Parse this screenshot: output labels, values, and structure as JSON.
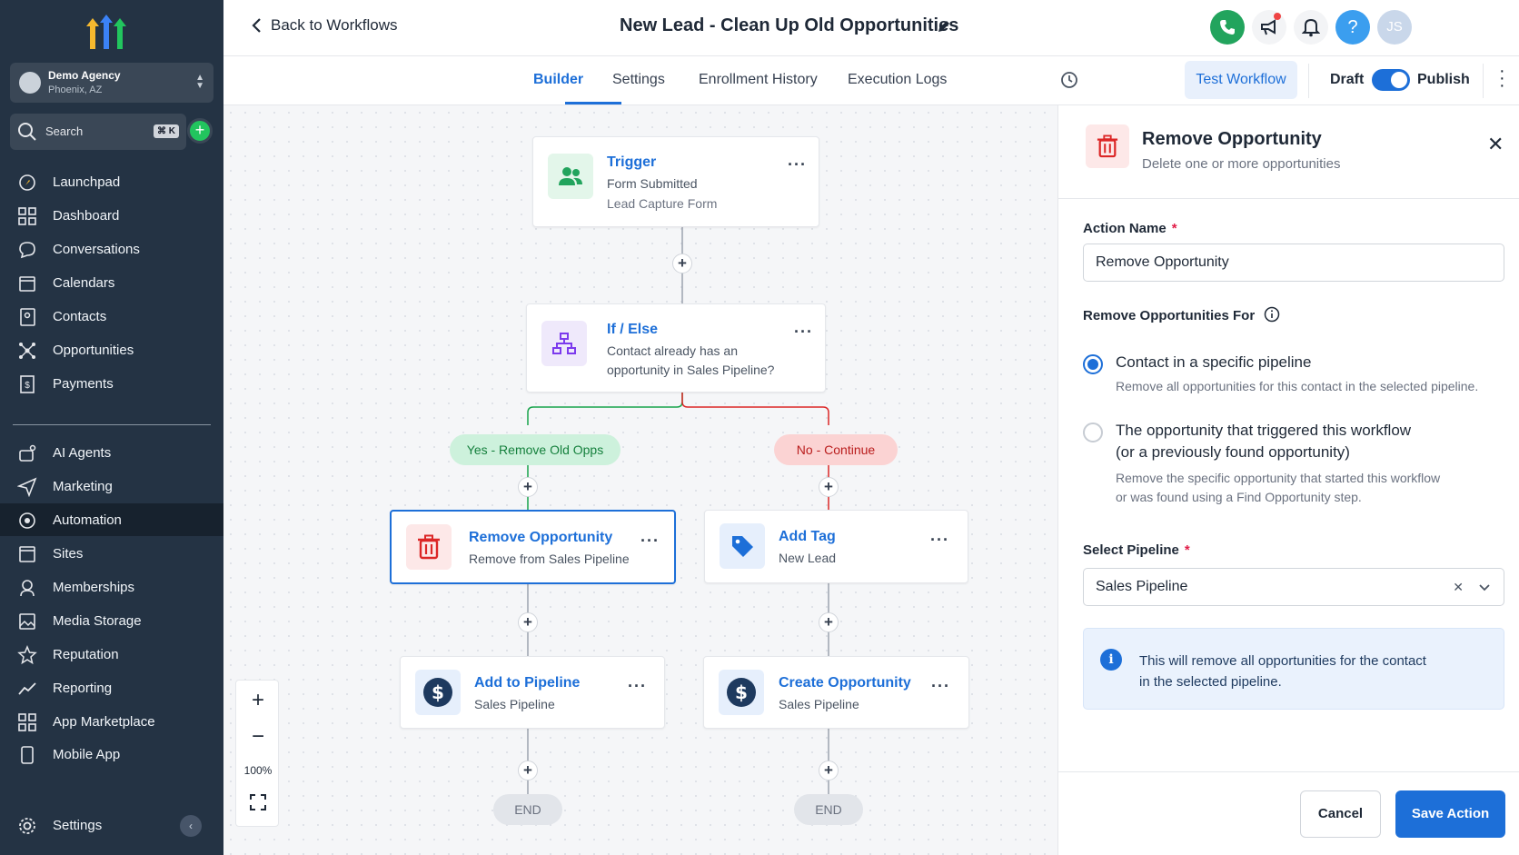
{
  "sidebar": {
    "account": {
      "name": "Demo Agency",
      "location": "Phoenix, AZ"
    },
    "search": {
      "label": "Search",
      "shortcut": "⌘ K"
    },
    "items": [
      {
        "label": "Launchpad",
        "icon": "rocket-icon"
      },
      {
        "label": "Dashboard",
        "icon": "grid-icon"
      },
      {
        "label": "Conversations",
        "icon": "chat-icon"
      },
      {
        "label": "Calendars",
        "icon": "calendar-icon"
      },
      {
        "label": "Contacts",
        "icon": "contact-icon"
      },
      {
        "label": "Opportunities",
        "icon": "network-icon"
      },
      {
        "label": "Payments",
        "icon": "receipt-icon"
      },
      {
        "label": "AI Agents",
        "icon": "ai-agent-icon"
      },
      {
        "label": "Marketing",
        "icon": "send-icon"
      },
      {
        "label": "Automation",
        "icon": "automation-icon",
        "active": true
      },
      {
        "label": "Sites",
        "icon": "sites-icon"
      },
      {
        "label": "Memberships",
        "icon": "membership-icon"
      },
      {
        "label": "Media Storage",
        "icon": "image-icon"
      },
      {
        "label": "Reputation",
        "icon": "star-icon"
      },
      {
        "label": "Reporting",
        "icon": "trend-icon"
      },
      {
        "label": "App Marketplace",
        "icon": "apps-icon"
      },
      {
        "label": "Mobile App",
        "icon": "phone-icon"
      }
    ],
    "settings": "Settings"
  },
  "header": {
    "back": "Back to Workflows",
    "title": "New Lead - Clean Up Old Opportunities",
    "avatar_initials": "JS",
    "help": "?"
  },
  "tabs": [
    "Builder",
    "Settings",
    "Enrollment History",
    "Execution Logs"
  ],
  "toolbar": {
    "test": "Test Workflow",
    "draft": "Draft",
    "publish": "Publish"
  },
  "canvas": {
    "trigger": {
      "title": "Trigger",
      "line1": "Form Submitted",
      "line2": "Lead Capture Form"
    },
    "ifelse": {
      "title": "If / Else",
      "line1": "Contact already has an",
      "line2": "opportunity in Sales Pipeline?"
    },
    "yes_branch": "Yes - Remove Old Opps",
    "no_branch": "No - Continue",
    "remove_opp": {
      "title": "Remove Opportunity",
      "sub": "Remove from Sales Pipeline"
    },
    "add_tag": {
      "title": "Add Tag",
      "sub": "New Lead"
    },
    "add_pipeline": {
      "title": "Add to Pipeline",
      "sub": "Sales Pipeline"
    },
    "create_opp": {
      "title": "Create Opportunity",
      "sub": "Sales Pipeline"
    },
    "end": "END",
    "zoom": "100%",
    "colors": {
      "yes": "#16a34a",
      "no": "#dc2626",
      "accent": "#1d6fd8"
    }
  },
  "panel": {
    "title": "Remove Opportunity",
    "subtitle": "Delete one or more opportunities",
    "action_name_label": "Action Name",
    "action_name_value": "Remove Opportunity",
    "remove_for_label": "Remove Opportunities For",
    "option1": {
      "label": "Contact in a specific pipeline",
      "desc": "Remove all opportunities for this contact in the selected pipeline.",
      "selected": true
    },
    "option2": {
      "label1": "The opportunity that triggered this workflow",
      "label2": "(or a previously found opportunity)",
      "desc1": "Remove the specific opportunity that started this workflow",
      "desc2": "or was found using a Find Opportunity step.",
      "selected": false
    },
    "pipeline_label": "Select Pipeline",
    "pipeline_value": "Sales Pipeline",
    "info_line1": "This will remove all opportunities for the contact",
    "info_line2": "in the selected pipeline.",
    "cancel": "Cancel",
    "save": "Save Action"
  }
}
